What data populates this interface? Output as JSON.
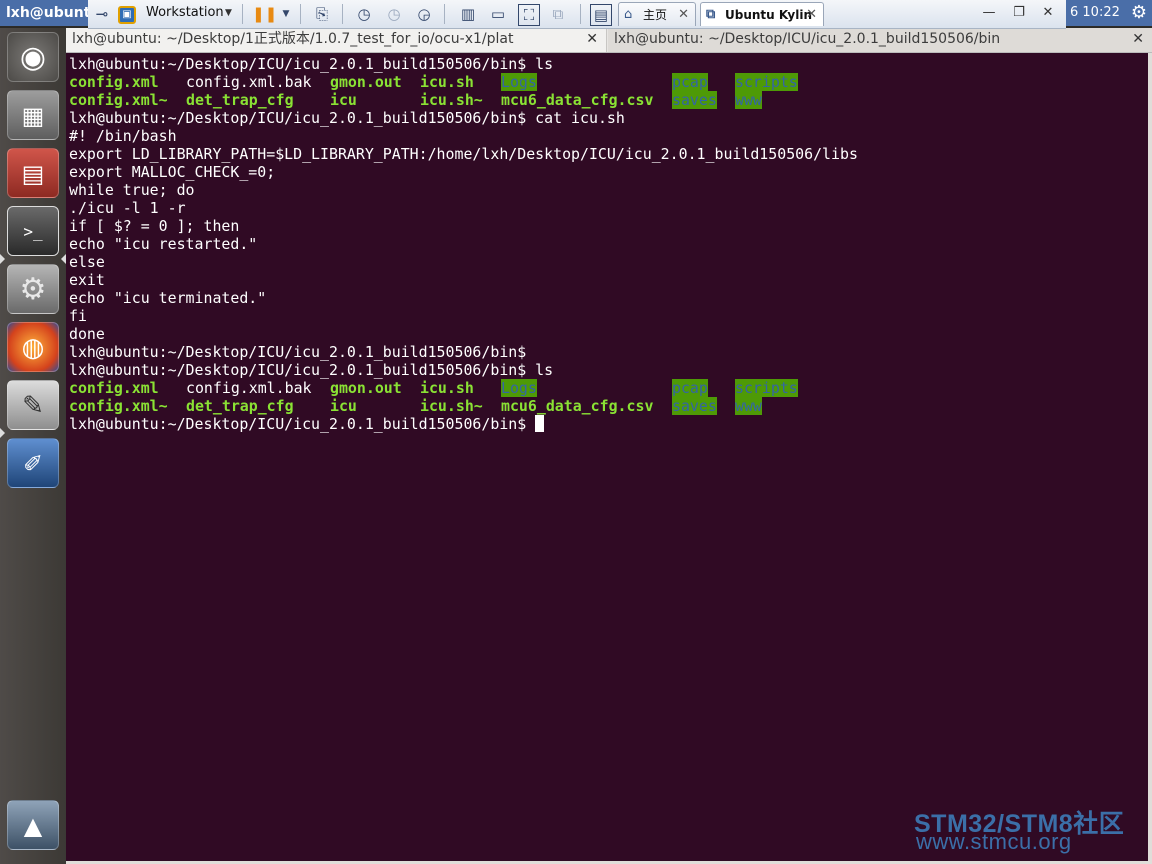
{
  "topbar": {
    "window_title": "lxh@ubunt",
    "clock": "6 10:22",
    "settings_icon": "gear-icon"
  },
  "vmware": {
    "menu_label": "Workstation",
    "tabs": [
      {
        "label": "主页",
        "icon": "home-icon"
      },
      {
        "label": "Ubuntu Kylin",
        "icon": "vm-icon"
      }
    ]
  },
  "launcher": {
    "items": [
      {
        "name": "dash-ubuntu-icon",
        "color": "#d05a2a"
      },
      {
        "name": "calculator-icon",
        "color": "#6b6b6b"
      },
      {
        "name": "file-cabinet-icon",
        "color": "#c0423a"
      },
      {
        "name": "terminal-icon",
        "color": "#2b2b2b"
      },
      {
        "name": "system-settings-icon",
        "color": "#8a8a8a"
      },
      {
        "name": "firefox-icon",
        "color": "#e66000"
      },
      {
        "name": "text-editor-icon",
        "color": "#7a7a7a"
      },
      {
        "name": "screen-editor-icon",
        "color": "#2f5d9e"
      },
      {
        "name": "workspace-switcher-icon",
        "color": "#556677"
      }
    ]
  },
  "terminal_tabs": [
    {
      "title": "lxh@ubuntu: ~/Desktop/1正式版本/1.0.7_test_for_io/ocu-x1/plat",
      "active": false
    },
    {
      "title": "lxh@ubuntu: ~/Desktop/ICU/icu_2.0.1_build150506/bin",
      "active": true
    }
  ],
  "terminal": {
    "prompt": "lxh@ubuntu:~/Desktop/ICU/icu_2.0.1_build150506/bin$",
    "cmd_ls": " ls",
    "cmd_cat": " cat icu.sh",
    "ls_row1": [
      "config.xml",
      "config.xml.bak",
      "gmon.out",
      "icu.sh",
      "Logs",
      "pcap",
      "scripts"
    ],
    "ls_row2": [
      "config.xml~",
      "det_trap_cfg",
      "icu",
      "icu.sh~",
      "mcu6_data_cfg.csv",
      "saves",
      "www"
    ],
    "script_lines": [
      "#! /bin/bash",
      "export LD_LIBRARY_PATH=$LD_LIBRARY_PATH:/home/lxh/Desktop/ICU/icu_2.0.1_build150506/libs",
      "export MALLOC_CHECK_=0;",
      "while true; do",
      "./icu -l 1 -r",
      "if [ $? = 0 ]; then",
      "echo \"icu restarted.\"",
      "else",
      "exit",
      "echo \"icu terminated.\"",
      "fi",
      "done"
    ]
  },
  "watermark": {
    "line1": "STM32/STM8社区",
    "line2": "www.stmcu.org"
  }
}
